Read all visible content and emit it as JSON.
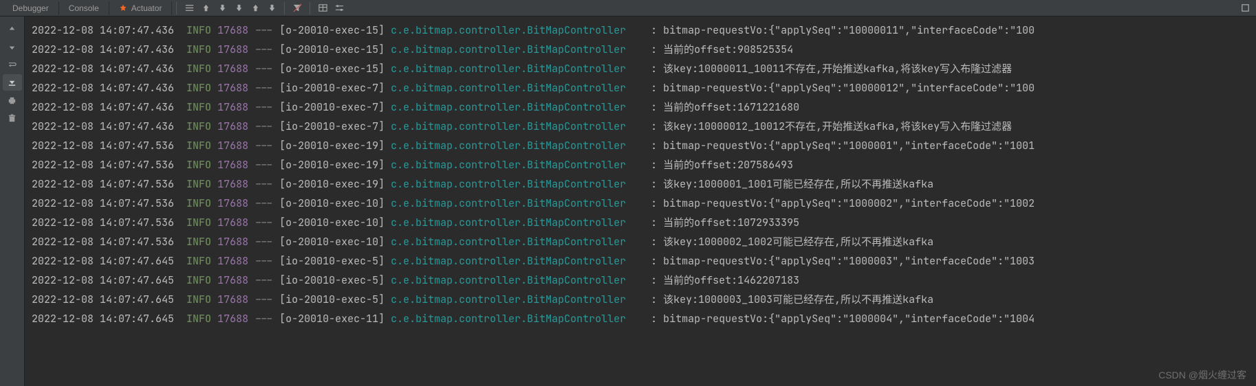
{
  "tabs": [
    "Debugger",
    "Console",
    "Actuator"
  ],
  "colors": {
    "bg": "#2b2b2b",
    "level": "#6A8759",
    "pid": "#9876AA",
    "logger": "#299999"
  },
  "watermark": "CSDN @烟火缠过客",
  "log_cols": [
    "timestamp",
    "level",
    "pid",
    "dash",
    "thread",
    "logger",
    "sep",
    "message"
  ],
  "lines": [
    {
      "ts": "2022-12-08 14:07:47.436",
      "lvl": "INFO",
      "pid": "17688",
      "thread": "[o-20010-exec-15]",
      "logger": "c.e.bitmap.controller.BitMapController",
      "msg": "bitmap-requestVo:{\"applySeq\":\"10000011\",\"interfaceCode\":\"100"
    },
    {
      "ts": "2022-12-08 14:07:47.436",
      "lvl": "INFO",
      "pid": "17688",
      "thread": "[o-20010-exec-15]",
      "logger": "c.e.bitmap.controller.BitMapController",
      "msg": "当前的offset:908525354"
    },
    {
      "ts": "2022-12-08 14:07:47.436",
      "lvl": "INFO",
      "pid": "17688",
      "thread": "[o-20010-exec-15]",
      "logger": "c.e.bitmap.controller.BitMapController",
      "msg": "该key:10000011_10011不存在,开始推送kafka,将该key写入布隆过滤器"
    },
    {
      "ts": "2022-12-08 14:07:47.436",
      "lvl": "INFO",
      "pid": "17688",
      "thread": "[io-20010-exec-7]",
      "logger": "c.e.bitmap.controller.BitMapController",
      "msg": "bitmap-requestVo:{\"applySeq\":\"10000012\",\"interfaceCode\":\"100"
    },
    {
      "ts": "2022-12-08 14:07:47.436",
      "lvl": "INFO",
      "pid": "17688",
      "thread": "[io-20010-exec-7]",
      "logger": "c.e.bitmap.controller.BitMapController",
      "msg": "当前的offset:1671221680"
    },
    {
      "ts": "2022-12-08 14:07:47.436",
      "lvl": "INFO",
      "pid": "17688",
      "thread": "[io-20010-exec-7]",
      "logger": "c.e.bitmap.controller.BitMapController",
      "msg": "该key:10000012_10012不存在,开始推送kafka,将该key写入布隆过滤器"
    },
    {
      "ts": "2022-12-08 14:07:47.536",
      "lvl": "INFO",
      "pid": "17688",
      "thread": "[o-20010-exec-19]",
      "logger": "c.e.bitmap.controller.BitMapController",
      "msg": "bitmap-requestVo:{\"applySeq\":\"1000001\",\"interfaceCode\":\"1001"
    },
    {
      "ts": "2022-12-08 14:07:47.536",
      "lvl": "INFO",
      "pid": "17688",
      "thread": "[o-20010-exec-19]",
      "logger": "c.e.bitmap.controller.BitMapController",
      "msg": "当前的offset:207586493"
    },
    {
      "ts": "2022-12-08 14:07:47.536",
      "lvl": "INFO",
      "pid": "17688",
      "thread": "[o-20010-exec-19]",
      "logger": "c.e.bitmap.controller.BitMapController",
      "msg": "该key:1000001_1001可能已经存在,所以不再推送kafka"
    },
    {
      "ts": "2022-12-08 14:07:47.536",
      "lvl": "INFO",
      "pid": "17688",
      "thread": "[o-20010-exec-10]",
      "logger": "c.e.bitmap.controller.BitMapController",
      "msg": "bitmap-requestVo:{\"applySeq\":\"1000002\",\"interfaceCode\":\"1002"
    },
    {
      "ts": "2022-12-08 14:07:47.536",
      "lvl": "INFO",
      "pid": "17688",
      "thread": "[o-20010-exec-10]",
      "logger": "c.e.bitmap.controller.BitMapController",
      "msg": "当前的offset:1072933395"
    },
    {
      "ts": "2022-12-08 14:07:47.536",
      "lvl": "INFO",
      "pid": "17688",
      "thread": "[o-20010-exec-10]",
      "logger": "c.e.bitmap.controller.BitMapController",
      "msg": "该key:1000002_1002可能已经存在,所以不再推送kafka"
    },
    {
      "ts": "2022-12-08 14:07:47.645",
      "lvl": "INFO",
      "pid": "17688",
      "thread": "[io-20010-exec-5]",
      "logger": "c.e.bitmap.controller.BitMapController",
      "msg": "bitmap-requestVo:{\"applySeq\":\"1000003\",\"interfaceCode\":\"1003"
    },
    {
      "ts": "2022-12-08 14:07:47.645",
      "lvl": "INFO",
      "pid": "17688",
      "thread": "[io-20010-exec-5]",
      "logger": "c.e.bitmap.controller.BitMapController",
      "msg": "当前的offset:1462207183"
    },
    {
      "ts": "2022-12-08 14:07:47.645",
      "lvl": "INFO",
      "pid": "17688",
      "thread": "[io-20010-exec-5]",
      "logger": "c.e.bitmap.controller.BitMapController",
      "msg": "该key:1000003_1003可能已经存在,所以不再推送kafka"
    },
    {
      "ts": "2022-12-08 14:07:47.645",
      "lvl": "INFO",
      "pid": "17688",
      "thread": "[o-20010-exec-11]",
      "logger": "c.e.bitmap.controller.BitMapController",
      "msg": "bitmap-requestVo:{\"applySeq\":\"1000004\",\"interfaceCode\":\"1004"
    }
  ]
}
